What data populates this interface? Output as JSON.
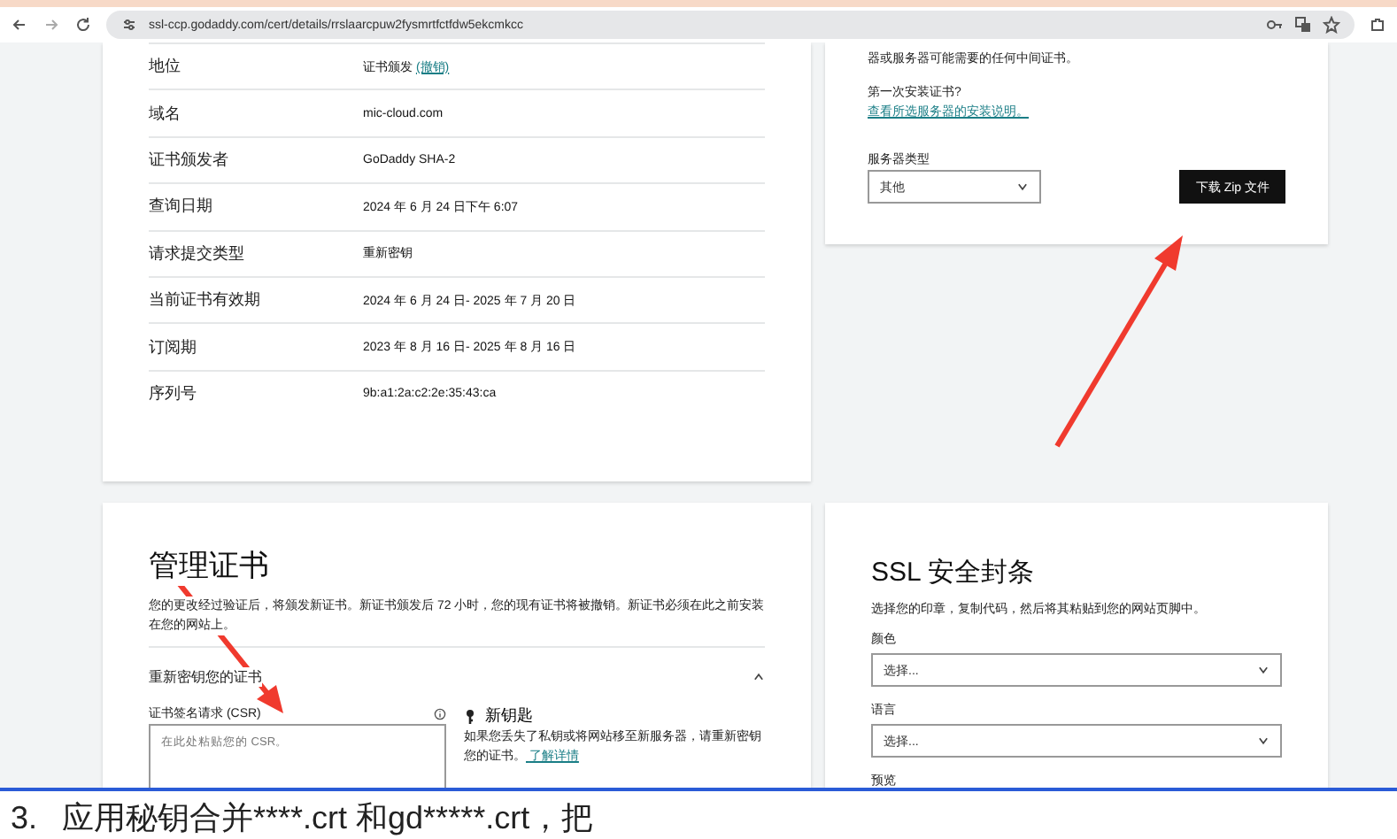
{
  "browser": {
    "url": "ssl-ccp.godaddy.com/cert/details/rrslaarcpuw2fysmrtfctfdw5ekcmkcc"
  },
  "details_card": {
    "rows": [
      {
        "label": "地位",
        "value": "证书颁发",
        "link": "(撤销)"
      },
      {
        "label": "域名",
        "value": "mic-cloud.com"
      },
      {
        "label": "证书颁发者",
        "value": "GoDaddy SHA-2"
      },
      {
        "label": "查询日期",
        "value": "2024 年 6 月 24 日下午 6:07"
      },
      {
        "label": "请求提交类型",
        "value": "重新密钥"
      },
      {
        "label": "当前证书有效期",
        "value": "2024 年 6 月 24 日- 2025 年 7 月 20 日"
      },
      {
        "label": "订阅期",
        "value": "2023 年 8 月 16 日- 2025 年 8 月 16 日"
      },
      {
        "label": "序列号",
        "value": "9b:a1:2a:c2:2e:35:43:ca"
      }
    ]
  },
  "install_card": {
    "intro": "器或服务器可能需要的任何中间证书。",
    "question": "第一次安装证书?",
    "link": "查看所选服务器的安装说明。",
    "server_type": {
      "label": "服务器类型",
      "value": "其他"
    },
    "download_button": "下载 Zip 文件"
  },
  "manage_card": {
    "title": "管理证书",
    "description": "您的更改经过验证后，将颁发新证书。新证书颁发后 72 小时，您的现有证书将被撤销。新证书必须在此之前安装在您的网站上。",
    "section": {
      "title": "重新密钥您的证书",
      "expanded": true
    },
    "csr": {
      "label": "证书签名请求 (CSR)",
      "placeholder": "在此处粘贴您的 CSR。"
    },
    "new_key": {
      "title": "新钥匙",
      "text": "如果您丢失了私钥或将网站移至新服务器，请重新密钥您的证书。",
      "link": "了解详情"
    }
  },
  "seal_card": {
    "title": "SSL 安全封条",
    "description": "选择您的印章，复制代码，然后将其粘贴到您的网站页脚中。",
    "fields": [
      {
        "label": "颜色",
        "placeholder": "选择..."
      },
      {
        "label": "语言",
        "placeholder": "选择..."
      }
    ],
    "preview_label": "预览"
  },
  "doc_caption": {
    "number": "3.",
    "text": "应用秘钥合并****.crt 和gd*****.crt，把"
  }
}
